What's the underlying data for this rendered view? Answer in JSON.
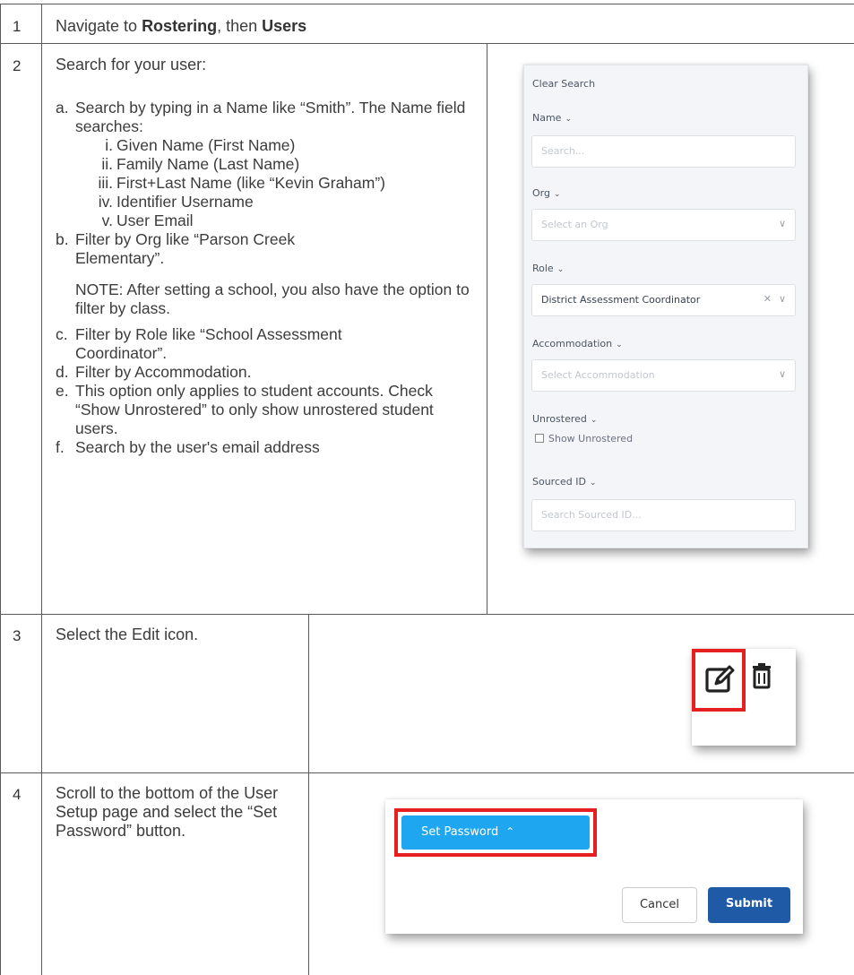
{
  "step1": {
    "number": "1",
    "prefix": "Navigate to ",
    "bold1": "Rostering",
    "middle": ", then ",
    "bold2": "Users"
  },
  "step2": {
    "number": "2",
    "heading": "Search for your user:",
    "a": {
      "mark": "a.",
      "text": "Search by typing in a Name like “Smith”. The Name field searches:",
      "subs": [
        {
          "mark": "i.",
          "text": "Given Name (First Name)"
        },
        {
          "mark": "ii.",
          "text": "Family Name (Last Name)"
        },
        {
          "mark": "iii.",
          "text": "First+Last Name (like “Kevin Graham”)"
        },
        {
          "mark": "iv.",
          "text": "Identifier Username"
        },
        {
          "mark": "v.",
          "text": "User Email"
        }
      ]
    },
    "b": {
      "mark": "b.",
      "text": "Filter by Org like “Parson Creek Elementary”."
    },
    "note": "NOTE: After setting a school, you also have the option to filter by class.",
    "c": {
      "mark": "c.",
      "text": "Filter by Role like “School Assessment Coordinator”."
    },
    "d": {
      "mark": "d.",
      "text": "Filter by Accommodation."
    },
    "e": {
      "mark": "e.",
      "text": "This option only applies to student accounts. Check “Show Unrostered” to only show unrostered student users."
    },
    "f": {
      "mark": "f.",
      "text": "Search by the user's email address"
    }
  },
  "panel": {
    "clear_search": "Clear Search",
    "name_label": "Name",
    "name_placeholder": "Search...",
    "org_label": "Org",
    "org_placeholder": "Select an Org",
    "role_label": "Role",
    "role_value": "District Assessment Coordinator",
    "accommodation_label": "Accommodation",
    "accommodation_placeholder": "Select Accommodation",
    "unrostered_label": "Unrostered",
    "show_unrostered": "Show Unrostered",
    "sourced_id_label": "Sourced ID",
    "sourced_id_placeholder": "Search Sourced ID..."
  },
  "step3": {
    "number": "3",
    "text": "Select the Edit icon."
  },
  "step4": {
    "number": "4",
    "text": "Scroll to the bottom of the User Setup page and select the “Set Password” button.",
    "set_password": "Set Password",
    "cancel": "Cancel",
    "submit": "Submit"
  },
  "colors": {
    "highlight": "#e62020",
    "primary_blue": "#1ea7f0",
    "submit_blue": "#1f5aa6",
    "table_line": "#5a5a5a"
  }
}
